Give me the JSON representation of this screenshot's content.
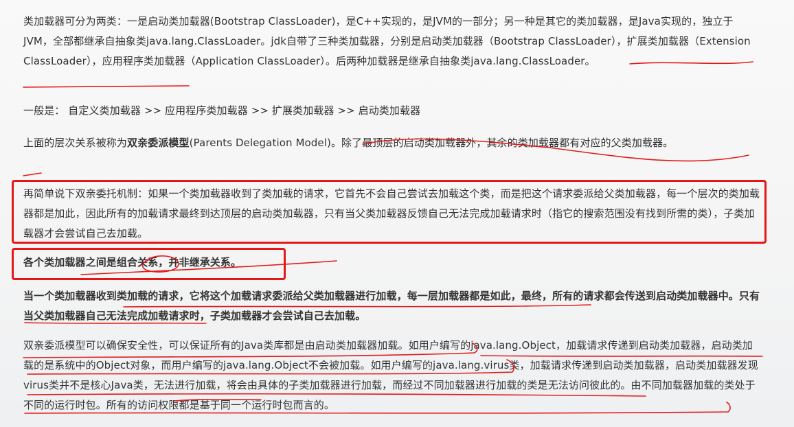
{
  "paragraphs": {
    "p1": "类加载器可分为两类：一是启动类加载器(Bootstrap ClassLoader)，是C++实现的，是JVM的一部分；另一种是其它的类加载器，是Java实现的，独立于JVM，全部都继承自抽象类java.lang.ClassLoader。jdk自带了三种类加载器，分别是启动类加载器（Bootstrap ClassLoader），扩展类加载器（Extension ClassLoader），应用程序类加载器（Application ClassLoader）。后两种加载器是继承自抽象类java.lang.ClassLoader。",
    "p2": "一般是： 自定义类加载器 >> 应用程序类加载器 >> 扩展类加载器 >> 启动类加载器",
    "p3_prefix": "上面的层次关系被称为",
    "p3_bold": "双亲委派模型",
    "p3_suffix": "(Parents Delegation Model)。除了最顶层的启动类加载器外，其余的类加载器都有对应的父类加载器。",
    "p4": "再简单说下双亲委托机制：如果一个类加载器收到了类加载的请求，它首先不会自己尝试去加载这个类，而是把这个请求委派给父类加载器，每一个层次的类加载器都是加此，因此所有的加载请求最终到达顶层的启动类加载器，只有当父类加载器反馈自己无法完成加载请求时（指它的搜索范围没有找到所需的类），子类加载器才会尝试自己去加载。",
    "p5": "各个类加载器之间是组合关系，并非继承关系。",
    "p6": "当一个类加载器收到类加载的请求，它将这个加载请求委派给父类加载器进行加载，每一层加载器都是如此，最终，所有的请求都会传送到启动类加载器中。只有当父类加载器自己无法完成加载请求时，子类加载器才会尝试自己去加载。",
    "p7": "双亲委派模型可以确保安全性，可以保证所有的Java类库都是由启动类加载器加载。如用户编写的java.lang.Object，加载请求传递到启动类加载器，启动类加载的是系统中的Object对象，而用户编写的java.lang.Object不会被加载。如用户编写的java.lang.virus类，加载请求传递到启动类加载器，启动类加载器发现virus类并不是核心Java类，无法进行加载，将会由具体的子类加载器进行加载，而经过不同加载器进行加载的类是无法访问彼此的。由不同加载器加载的类处于不同的运行时包。所有的访问权限都是基于同一个运行时包而言的。"
  },
  "colors": {
    "annotation_red": "#e31b1b",
    "text": "#333333",
    "background": "#f7f7f7"
  }
}
